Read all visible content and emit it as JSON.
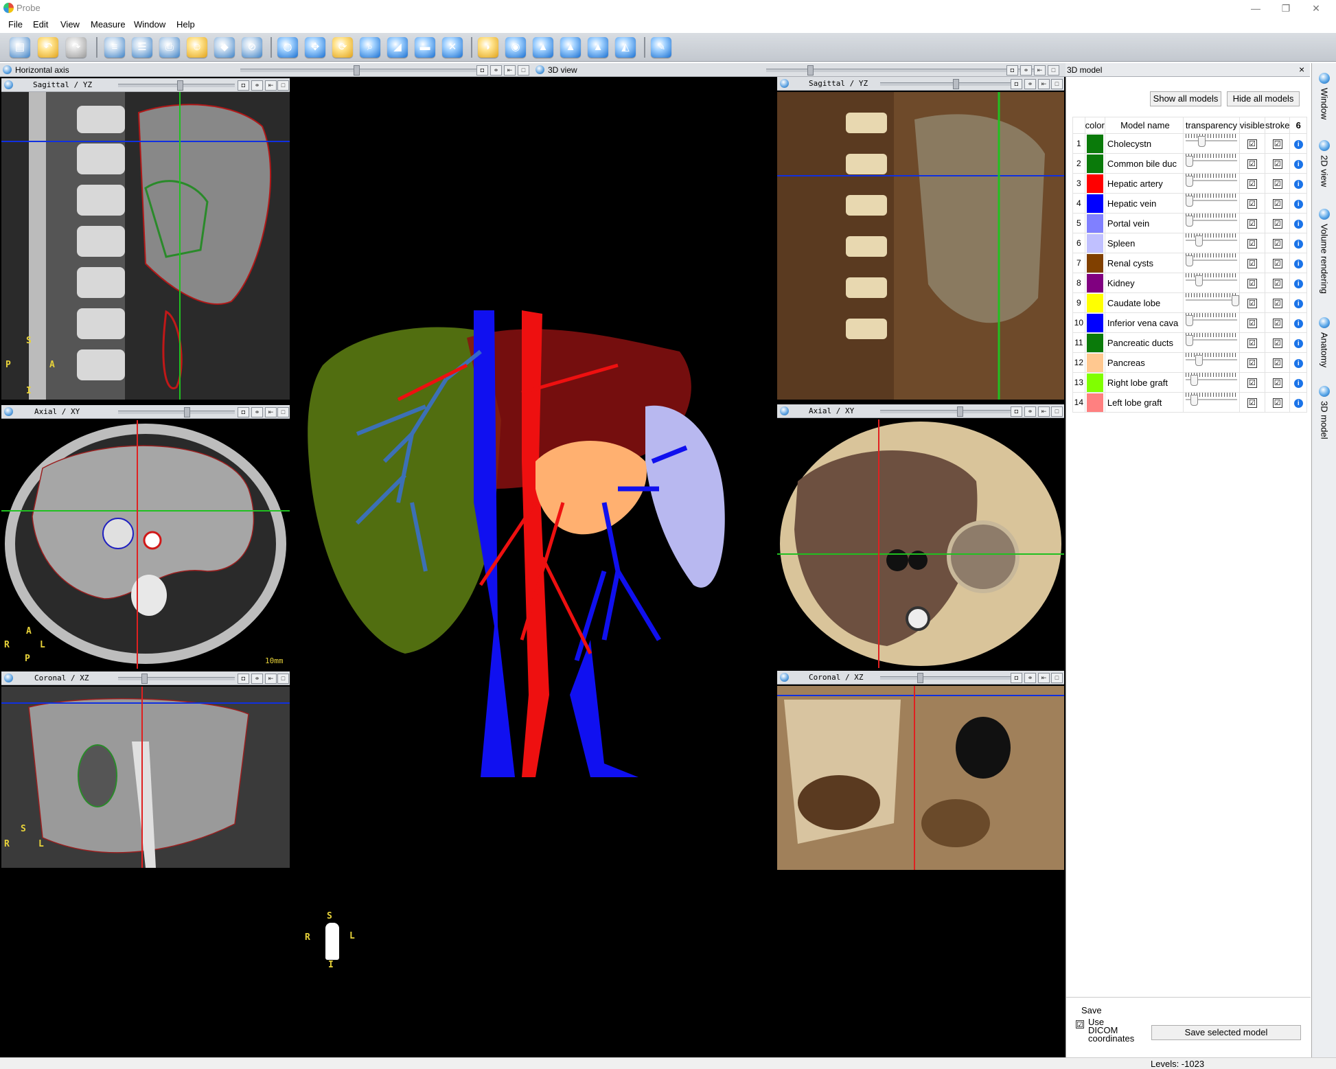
{
  "window": {
    "title": "Probe"
  },
  "menu": [
    "File",
    "Edit",
    "View",
    "Measure",
    "Window",
    "Help"
  ],
  "left_dock": {
    "title": "Horizontal axis",
    "views": [
      {
        "label": "Sagittal / YZ"
      },
      {
        "label": "Axial / XY",
        "scale": "10mm"
      },
      {
        "label": "Coronal / XZ"
      }
    ]
  },
  "center": {
    "title": "3D view"
  },
  "right_views": [
    {
      "label": "Sagittal / YZ"
    },
    {
      "label": "Axial / XY"
    },
    {
      "label": "Coronal / XZ"
    }
  ],
  "orientation": {
    "s": "S",
    "i": "I",
    "r": "R",
    "l": "L",
    "a": "A",
    "p": "P"
  },
  "model_panel": {
    "title": "3D model",
    "close": "×",
    "show_all_label": "Show all models",
    "hide_all_label": "Hide all models",
    "columns": {
      "color": "color",
      "name": "Model name",
      "transparency": "transparency",
      "visible": "visible",
      "stroke": "stroke",
      "count": "6"
    },
    "models": [
      {
        "n": "1",
        "name": "Cholecystn",
        "color": "#0a7a0a",
        "transparency": 0.25
      },
      {
        "n": "2",
        "name": "Common bile duc",
        "color": "#0a7a0a",
        "transparency": 0.0
      },
      {
        "n": "3",
        "name": "Hepatic artery",
        "color": "#ff0000",
        "transparency": 0.0
      },
      {
        "n": "4",
        "name": "Hepatic vein",
        "color": "#0000ff",
        "transparency": 0.0
      },
      {
        "n": "5",
        "name": "Portal vein",
        "color": "#8080ff",
        "transparency": 0.0
      },
      {
        "n": "6",
        "name": "Spleen",
        "color": "#c0c0ff",
        "transparency": 0.2
      },
      {
        "n": "7",
        "name": "Renal cysts",
        "color": "#804000",
        "transparency": 0.0
      },
      {
        "n": "8",
        "name": "Kidney",
        "color": "#800080",
        "transparency": 0.2
      },
      {
        "n": "9",
        "name": "Caudate lobe",
        "color": "#ffff00",
        "transparency": 0.95
      },
      {
        "n": "10",
        "name": "Inferior vena cava",
        "color": "#0000ff",
        "transparency": 0.0
      },
      {
        "n": "11",
        "name": "Pancreatic ducts",
        "color": "#0a7a0a",
        "transparency": 0.0
      },
      {
        "n": "12",
        "name": "Pancreas",
        "color": "#ffc890",
        "transparency": 0.2
      },
      {
        "n": "13",
        "name": "Right lobe graft",
        "color": "#80ff00",
        "transparency": 0.1
      },
      {
        "n": "14",
        "name": "Left lobe graft",
        "color": "#ff8080",
        "transparency": 0.1
      }
    ],
    "check_mark": "☑",
    "info_mark": "i",
    "save": {
      "label": "Save",
      "use_dicom_label": "Use DICOM coordinates",
      "save_button": "Save selected model"
    }
  },
  "vertical_tabs": [
    "Window",
    "2D view",
    "Volume rendering",
    "Anatomy",
    "3D model"
  ],
  "status": {
    "levels": "Levels: -1023"
  }
}
